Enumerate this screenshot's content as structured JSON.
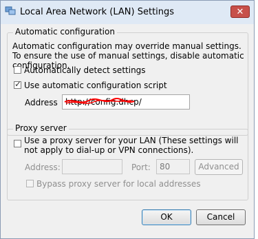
{
  "window": {
    "title": "Local Area Network (LAN) Settings",
    "close_label": "✕"
  },
  "auto_config": {
    "group_title": "Automatic configuration",
    "description": "Automatic configuration may override manual settings.  To ensure the use of manual settings, disable automatic configuration.",
    "detect_label": "Automatically detect settings",
    "detect_checked": false,
    "script_label": "Use automatic configuration script",
    "script_checked": true,
    "address_label": "Address",
    "address_value": "http://config.dhcp/"
  },
  "proxy": {
    "group_title": "Proxy server",
    "use_proxy_label": "Use a proxy server for your LAN (These settings will not apply to dial-up or VPN connections).",
    "use_proxy_checked": false,
    "address_label": "Address:",
    "address_value": "",
    "port_label": "Port:",
    "port_value": "80",
    "advanced_label": "Advanced",
    "bypass_label": "Bypass proxy server for local addresses",
    "bypass_checked": false
  },
  "buttons": {
    "ok_label": "OK",
    "cancel_label": "Cancel"
  },
  "colors": {
    "close_button": "#c7504a",
    "redaction": "#ff0000"
  }
}
